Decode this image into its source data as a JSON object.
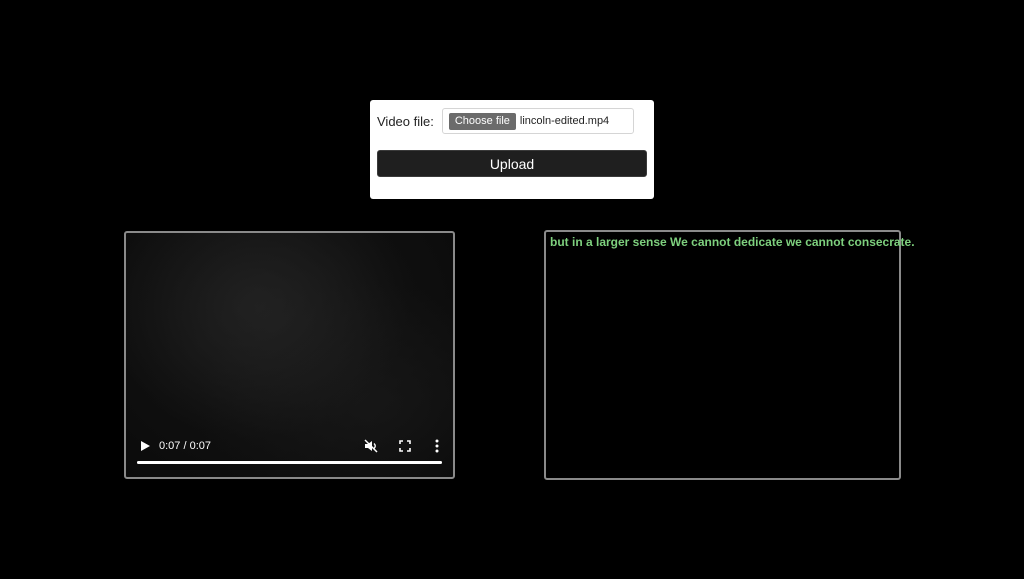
{
  "upload_form": {
    "file_label": "Video file:",
    "choose_button_label": "Choose file",
    "selected_file_name": "lincoln-edited.mp4",
    "upload_button_label": "Upload"
  },
  "video_player": {
    "time_display": "0:07 / 0:07",
    "progress_fraction": 1.0,
    "muted": true,
    "icons": {
      "play": "play-icon",
      "mute": "volume-muted-icon",
      "fullscreen": "fullscreen-icon",
      "more": "more-vertical-icon"
    }
  },
  "transcript": {
    "text": "but in a larger sense We cannot dedicate we cannot consecrate.",
    "color": "#7ed07e"
  },
  "colors": {
    "background": "#000000",
    "card_background": "#ffffff",
    "upload_button_background": "#1f1f1f",
    "panel_border": "#8a8a8a"
  }
}
